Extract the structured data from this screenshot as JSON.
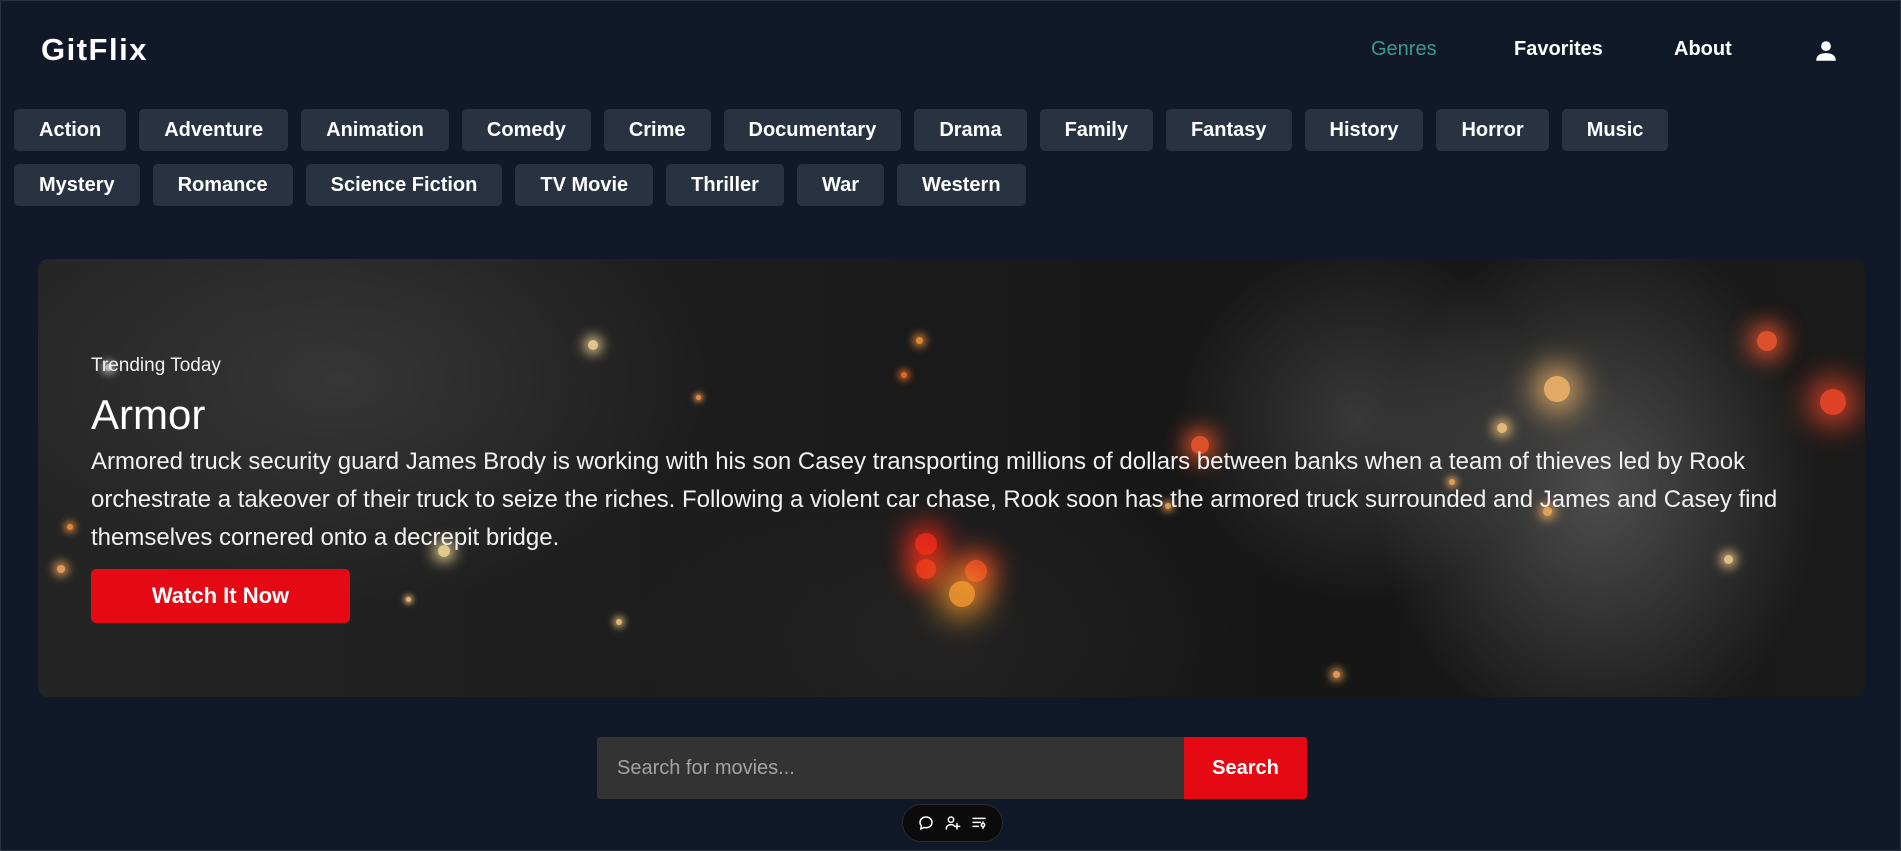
{
  "app": {
    "logo": "GitFlix"
  },
  "nav": {
    "genres": "Genres",
    "favorites": "Favorites",
    "about": "About",
    "active_color": "#3a9b8a"
  },
  "genres": [
    "Action",
    "Adventure",
    "Animation",
    "Comedy",
    "Crime",
    "Documentary",
    "Drama",
    "Family",
    "Fantasy",
    "History",
    "Horror",
    "Music",
    "Mystery",
    "Romance",
    "Science Fiction",
    "TV Movie",
    "Thriller",
    "War",
    "Western"
  ],
  "hero": {
    "label": "Trending Today",
    "title": "Armor",
    "description": "Armored truck security guard James Brody is working with his son Casey transporting millions of dollars between banks when a team of thieves led by Rook orchestrate a takeover of their truck to seize the riches. Following a violent car chase, Rook soon has the armored truck surrounded and James and Casey find themselves cornered onto a decrepit bridge.",
    "cta": "Watch It Now"
  },
  "search": {
    "placeholder": "Search for movies...",
    "value": "",
    "button": "Search"
  },
  "toolbar": {
    "icons": [
      "chat-icon",
      "add-user-icon",
      "list-settings-icon"
    ]
  },
  "colors": {
    "background": "#111827",
    "accent_red": "#e50914",
    "genre_button": "#283241"
  }
}
